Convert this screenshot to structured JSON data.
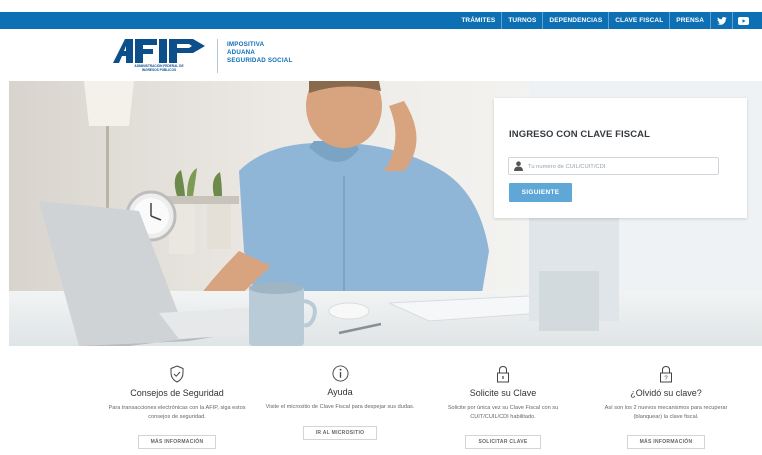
{
  "topnav": {
    "items": [
      "TRÁMITES",
      "TURNOS",
      "DEPENDENCIAS",
      "CLAVE FISCAL",
      "PRENSA"
    ],
    "social": [
      "twitter-icon",
      "youtube-icon"
    ]
  },
  "header": {
    "logo_text": "AFIP",
    "logo_subtitle_1": "ADMINISTRACIÓN FEDERAL DE",
    "logo_subtitle_2": "INGRESOS PÚBLICOS",
    "links": [
      "IMPOSITIVA",
      "ADUANA",
      "SEGURIDAD SOCIAL"
    ]
  },
  "login": {
    "title": "INGRESO CON CLAVE FISCAL",
    "placeholder": "Tu numero de CUIL/CUIT/CDI",
    "button": "SIGUIENTE"
  },
  "features": [
    {
      "icon": "shield-check-icon",
      "title": "Consejos de Seguridad",
      "desc": "Para transacciones electrónicas con la AFIP, siga estos consejos de seguridad.",
      "button": "MÁS INFORMACIÓN"
    },
    {
      "icon": "info-icon",
      "title": "Ayuda",
      "desc": "Visite el micrositio de Clave Fiscal para despejar sus dudas.",
      "button": "IR AL MICROSITIO"
    },
    {
      "icon": "lock-icon",
      "title": "Solicite su Clave",
      "desc": "Solicite por única vez su Clave Fiscal con su CUIT/CUIL/CDI habilitado.",
      "button": "SOLICITAR CLAVE"
    },
    {
      "icon": "lock-question-icon",
      "title": "¿Olvidó su clave?",
      "desc": "Así son los 2 nuevos mecanismos para recuperar (blanquear) la clave fiscal.",
      "button": "MÁS INFORMACIÓN"
    }
  ],
  "colors": {
    "brand_blue": "#0d6fb4",
    "button_blue": "#5fa7d7"
  }
}
